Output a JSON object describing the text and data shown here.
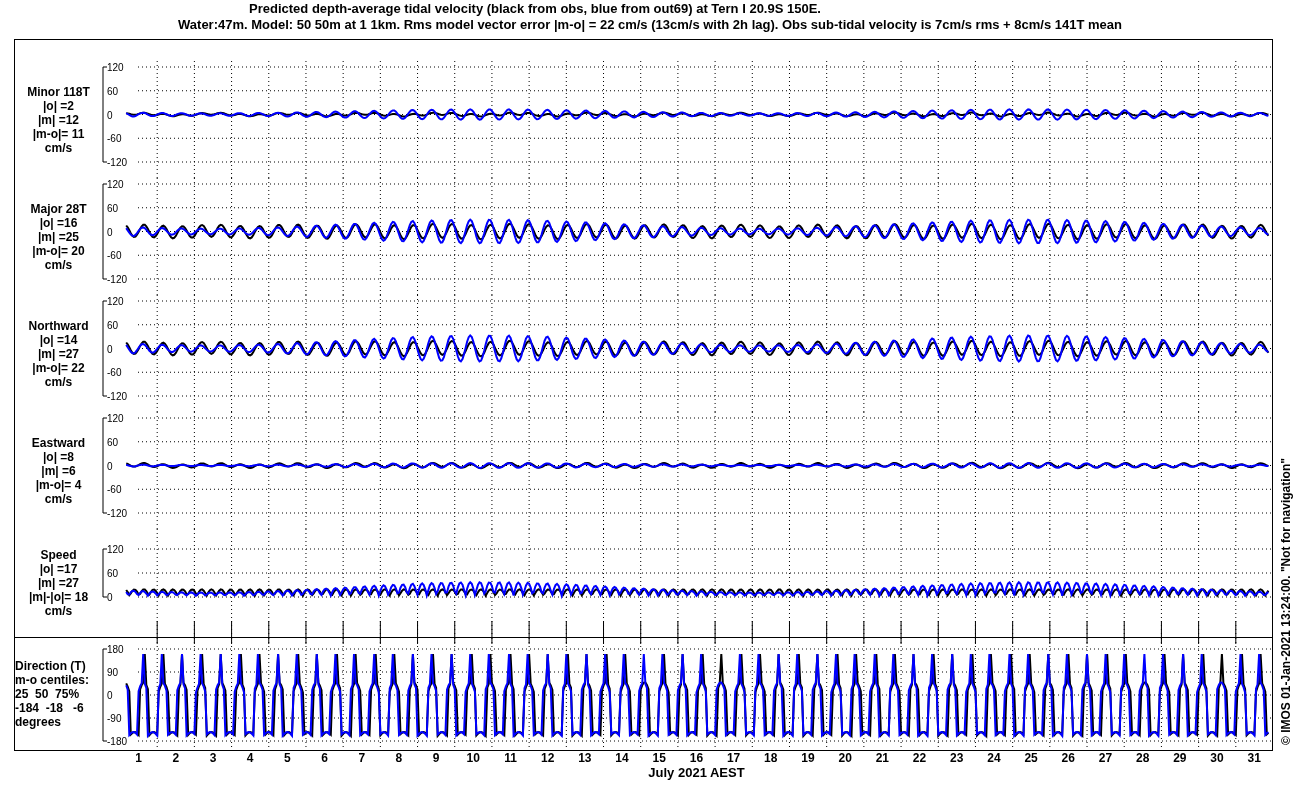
{
  "title": {
    "line_1": "Predicted depth-average tidal velocity (black from obs, blue from out69) at Tern I 20.9S 150E.",
    "line_2": "Water:47m. Model: 50 50m at 1 1km. Rms model vector error |m-o| = 22 cm/s (13cm/s with 2h lag). Obs sub-tidal velocity is 7cm/s rms + 8cm/s 141T mean"
  },
  "panels": [
    {
      "kind": "velocity",
      "label_lines": [
        "Minor 118T",
        "|o| =2",
        "|m| =12",
        "|m-o|= 11",
        "cm/s"
      ],
      "yticks": [
        "120",
        "60",
        "0",
        "-60",
        "-120"
      ]
    },
    {
      "kind": "velocity",
      "label_lines": [
        "Major 28T",
        "|o| =16",
        "|m| =25",
        "|m-o|= 20",
        "cm/s"
      ],
      "yticks": [
        "120",
        "60",
        "0",
        "-60",
        "-120"
      ]
    },
    {
      "kind": "velocity",
      "label_lines": [
        "Northward",
        "|o| =14",
        "|m| =27",
        "|m-o|= 22",
        "cm/s"
      ],
      "yticks": [
        "120",
        "60",
        "0",
        "-60",
        "-120"
      ]
    },
    {
      "kind": "velocity",
      "label_lines": [
        "Eastward",
        "|o| =8",
        "|m| =6",
        "|m-o|= 4",
        "cm/s"
      ],
      "yticks": [
        "120",
        "60",
        "0",
        "-60",
        "-120"
      ]
    },
    {
      "kind": "speed",
      "label_lines": [
        "Speed",
        "|o| =17",
        "|m| =27",
        "|m|-|o|= 18",
        "cm/s"
      ],
      "yticks": [
        "120",
        "60",
        "0"
      ]
    },
    {
      "kind": "direction",
      "label_lines": [
        "Direction (T)",
        "m-o centiles:",
        "25  50  75%",
        "-184  -18   -6",
        "degrees"
      ],
      "yticks": [
        "180",
        "90",
        "0",
        "-90",
        "-180"
      ]
    }
  ],
  "x_axis": {
    "ticks": [
      "1",
      "2",
      "3",
      "4",
      "5",
      "6",
      "7",
      "8",
      "9",
      "10",
      "11",
      "12",
      "13",
      "14",
      "15",
      "16",
      "17",
      "18",
      "19",
      "20",
      "21",
      "22",
      "23",
      "24",
      "25",
      "26",
      "27",
      "28",
      "29",
      "30",
      "31"
    ],
    "label": "July 2021 AEST"
  },
  "side_note": "© IMOS 01-Jan-2021 13:24:00. \"Not for navigation\""
}
